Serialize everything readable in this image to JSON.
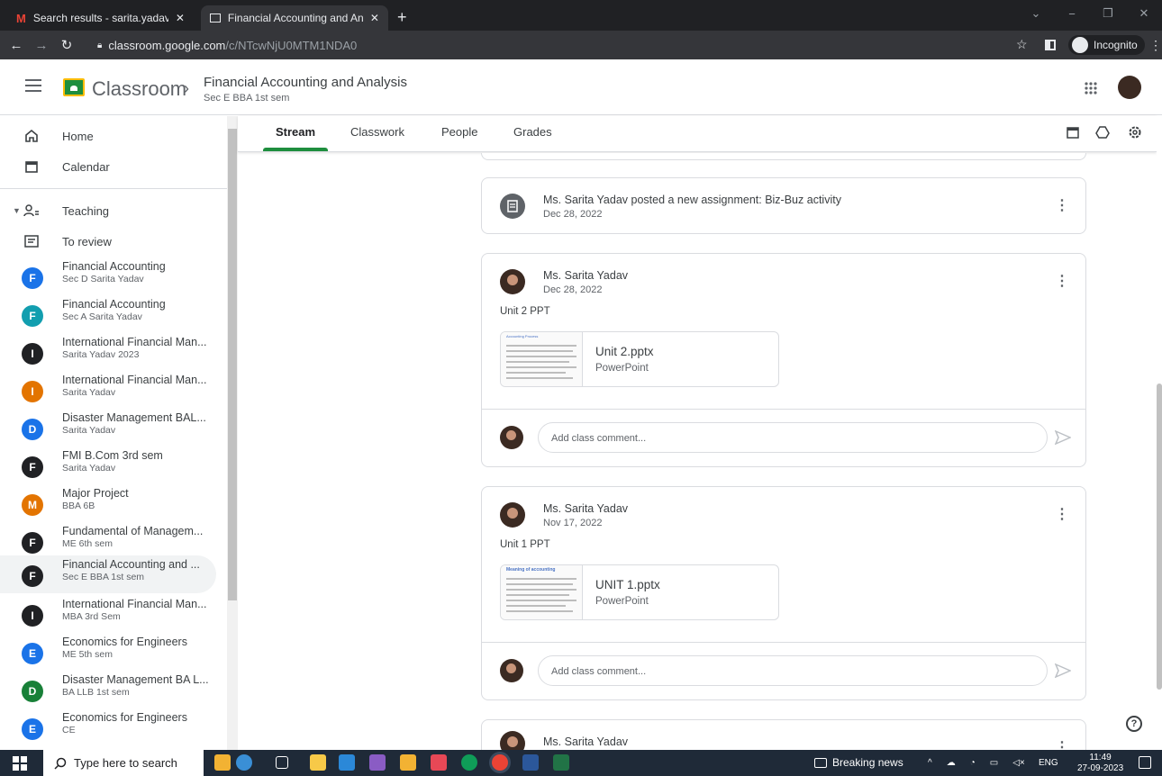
{
  "browser": {
    "tabs": [
      {
        "title": "Search results - sarita.yadav@me",
        "close": "✕"
      },
      {
        "title": "Financial Accounting and Analysis",
        "close": "✕"
      }
    ],
    "new_tab": "+",
    "url_host": "classroom.google.com",
    "url_path": "/c/NTcwNjU0MTM1NDA0",
    "incognito_label": "Incognito"
  },
  "header": {
    "brand": "Classroom",
    "class_title": "Financial Accounting and Analysis",
    "class_subtitle": "Sec E BBA 1st sem"
  },
  "sidebar": {
    "home": "Home",
    "calendar": "Calendar",
    "teaching": "Teaching",
    "to_review": "To review",
    "classes": [
      {
        "letter": "F",
        "color": "#1a73e8",
        "name": "Financial Accounting",
        "sub": "Sec D Sarita Yadav"
      },
      {
        "letter": "F",
        "color": "#129eaf",
        "name": "Financial Accounting",
        "sub": "Sec A Sarita Yadav"
      },
      {
        "letter": "I",
        "color": "#202124",
        "name": "International Financial Man...",
        "sub": "Sarita Yadav 2023"
      },
      {
        "letter": "I",
        "color": "#e37400",
        "name": "International Financial Man...",
        "sub": "Sarita Yadav"
      },
      {
        "letter": "D",
        "color": "#1a73e8",
        "name": "Disaster Management BAL...",
        "sub": "Sarita Yadav"
      },
      {
        "letter": "F",
        "color": "#202124",
        "name": "FMI B.Com 3rd sem",
        "sub": "Sarita Yadav"
      },
      {
        "letter": "M",
        "color": "#e37400",
        "name": "Major Project",
        "sub": "BBA 6B"
      },
      {
        "letter": "F",
        "color": "#202124",
        "name": "Fundamental of Managem...",
        "sub": "ME 6th sem"
      },
      {
        "letter": "F",
        "color": "#202124",
        "name": "Financial Accounting and ...",
        "sub": "Sec E BBA 1st sem"
      },
      {
        "letter": "I",
        "color": "#202124",
        "name": "International Financial Man...",
        "sub": "MBA 3rd Sem"
      },
      {
        "letter": "E",
        "color": "#1a73e8",
        "name": "Economics for Engineers",
        "sub": "ME 5th sem"
      },
      {
        "letter": "D",
        "color": "#188038",
        "name": "Disaster Management BA L...",
        "sub": "BA LLB 1st sem"
      },
      {
        "letter": "E",
        "color": "#1a73e8",
        "name": "Economics for Engineers",
        "sub": "CE"
      }
    ]
  },
  "class_tabs": [
    "Stream",
    "Classwork",
    "People",
    "Grades"
  ],
  "stream": {
    "assignment": {
      "text": "Ms. Sarita Yadav posted a new assignment: Biz-Buz activity",
      "date": "Dec 28, 2022"
    },
    "posts": [
      {
        "author": "Ms. Sarita Yadav",
        "date": "Dec 28, 2022",
        "text": "Unit 2 PPT",
        "file": "Unit 2.pptx",
        "file_type": "PowerPoint",
        "thumb_title": "Accounting Process"
      },
      {
        "author": "Ms. Sarita Yadav",
        "date": "Nov 17, 2022",
        "text": "Unit 1 PPT",
        "file": "UNIT 1.pptx",
        "file_type": "PowerPoint",
        "thumb_title": "Meaning of accounting"
      }
    ],
    "next_author": "Ms. Sarita Yadav",
    "comment_placeholder": "Add class comment..."
  },
  "taskbar": {
    "search_placeholder": "Type here to search",
    "news": "Breaking news",
    "lang": "ENG",
    "time": "11:49",
    "date": "27-09-2023"
  },
  "colors": {
    "accent": "#1e8e3e"
  }
}
